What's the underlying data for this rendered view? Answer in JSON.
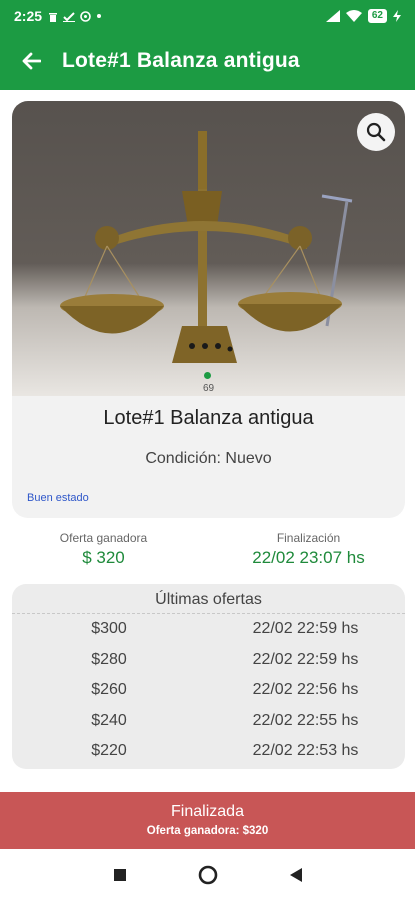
{
  "status_bar": {
    "time": "2:25",
    "battery": "62",
    "icons": [
      "trash-icon",
      "check-icon",
      "sync-icon",
      "dot-icon",
      "signal-icon",
      "wifi-icon",
      "battery-icon",
      "charging-icon"
    ]
  },
  "app_bar": {
    "title": "Lote#1 Balanza antigua",
    "back_icon": "arrow-left-icon"
  },
  "item": {
    "image_counter": "69",
    "title": "Lote#1 Balanza antigua",
    "condition": "Condición: Nuevo",
    "description": "Buen estado"
  },
  "summary": {
    "winning_label": "Oferta ganadora",
    "winning_value": "$ 320",
    "end_label": "Finalización",
    "end_value": "22/02 23:07 hs"
  },
  "offers": {
    "title": "Últimas ofertas",
    "rows": [
      {
        "amount": "$300",
        "date": "22/02 22:59 hs"
      },
      {
        "amount": "$280",
        "date": "22/02 22:59 hs"
      },
      {
        "amount": "$260",
        "date": "22/02 22:56 hs"
      },
      {
        "amount": "$240",
        "date": "22/02 22:55 hs"
      },
      {
        "amount": "$220",
        "date": "22/02 22:53 hs"
      }
    ]
  },
  "banner": {
    "status": "Finalizada",
    "detail": "Oferta ganadora: $320"
  },
  "colors": {
    "primary_green": "#1c9b43",
    "value_green": "#1f8a3b",
    "banner_red": "#c85656",
    "link_blue": "#2f57c9"
  }
}
